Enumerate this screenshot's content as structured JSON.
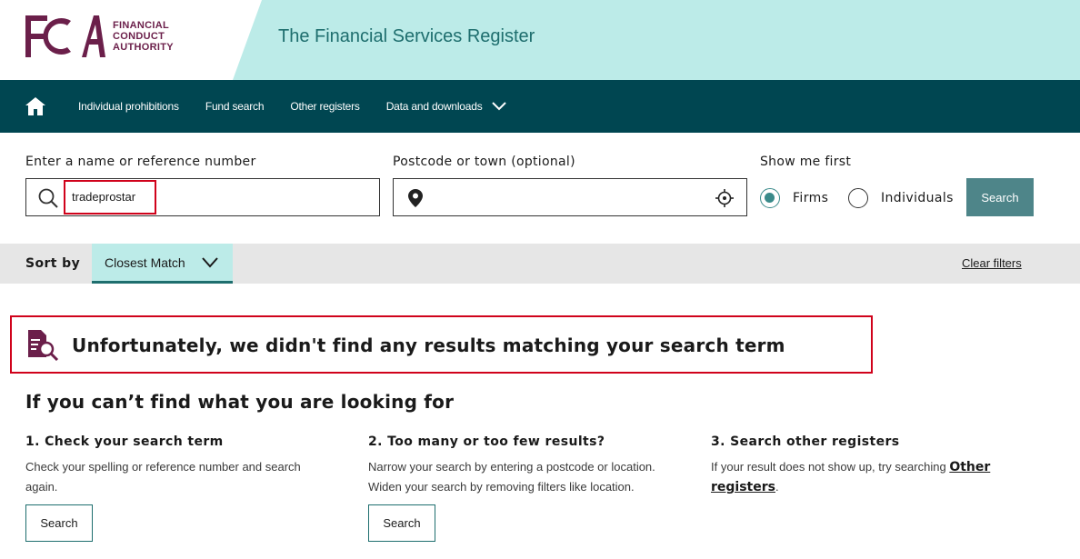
{
  "header": {
    "logo_letters": "FCA",
    "logo_lines": [
      "FINANCIAL",
      "CONDUCT",
      "AUTHORITY"
    ],
    "site_title": "The Financial Services Register"
  },
  "nav": {
    "home_icon": "home-icon",
    "items": [
      "Individual prohibitions",
      "Fund search",
      "Other registers",
      "Data and downloads"
    ]
  },
  "search": {
    "name_label": "Enter a name or reference number",
    "name_value": "tradeprostar",
    "postcode_label": "Postcode or town (optional)",
    "postcode_value": "",
    "show_first_label": "Show me first",
    "options": [
      "Firms",
      "Individuals"
    ],
    "selected_option": "Firms",
    "button_label": "Search"
  },
  "sort": {
    "label": "Sort by",
    "selected": "Closest Match",
    "clear_filters": "Clear filters"
  },
  "results": {
    "no_results_message": "Unfortunately, we didn't find any results matching your search term"
  },
  "help": {
    "title": "If you can’t find what you are looking for",
    "columns": [
      {
        "heading": "1. Check your search term",
        "text": "Check your spelling or reference number and search again.",
        "button": "Search"
      },
      {
        "heading": "2. Too many or too few results?",
        "text": "Narrow your search by entering a postcode or location. Widen your search by removing filters like location.",
        "button": "Search"
      },
      {
        "heading": "3. Search other registers",
        "text_before": "If your result does not show up, try searching ",
        "link": "Other registers",
        "text_after": "."
      }
    ]
  },
  "colors": {
    "nav_bg": "#004651",
    "header_teal": "#bcebe8",
    "brand_plum": "#6b1f4a",
    "highlight_red": "#d0021b",
    "button_teal": "#4e8589"
  }
}
